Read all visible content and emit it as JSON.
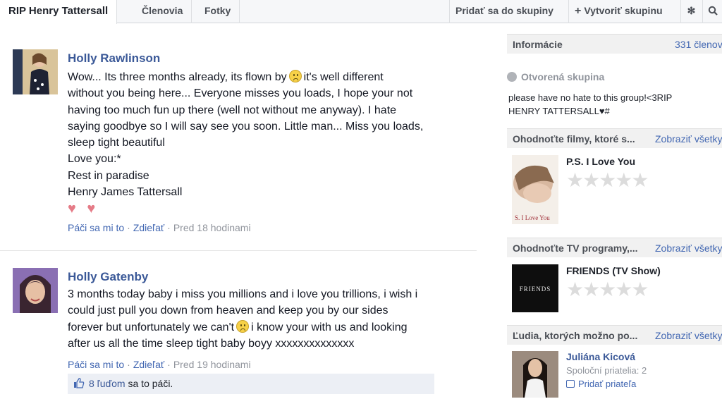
{
  "tabs": [
    {
      "label": "RIP Henry Tattersall"
    },
    {
      "label": "Členovia"
    },
    {
      "label": "Fotky"
    }
  ],
  "actions": {
    "join_label": "Pridať sa do skupiny",
    "create_label": "Vytvoriť skupinu"
  },
  "posts": [
    {
      "author": "Holly Rawlinson",
      "lines": [
        "Wow... Its three months already, its flown by",
        "it's well different",
        "without you being here... Everyone misses you loads, I hope your not",
        "having too much fun up there (well not without me anyway). I hate",
        "saying goodbye so I will say see you soon. Little man... Miss you loads,",
        "sleep tight beautiful",
        "Love you:*",
        "Rest in paradise",
        "Henry James Tattersall"
      ],
      "hearts": "♥ ♥",
      "like": "Páči sa mi to",
      "share": "Zdieľať",
      "time": "Pred 18 hodinami"
    },
    {
      "author": "Holly Gatenby",
      "lines": [
        "3 months today baby i miss you millions and i love you trillions, i wish i",
        "could just pull you down from heaven and keep you by our sides",
        "forever but unfortunately we can't",
        "i know your with us and looking",
        "after us all the time sleep tight baby boyy xxxxxxxxxxxxxx"
      ],
      "like": "Páči sa mi to",
      "share": "Zdieľať",
      "time": "Pred 19 hodinami",
      "likes_count": "8 ľuďom",
      "likes_suffix": "sa to páči."
    }
  ],
  "sidebar": {
    "info_label": "Informácie",
    "members": "331 členov",
    "group_type": "Otvorená skupina",
    "description_line1": "please have no hate to this group!<3RIP",
    "description_line2": "HENRY TATTERSALL♥#",
    "movies_head": "Ohodnoťte filmy, ktoré s...",
    "tv_head": "Ohodnoťte TV programy,...",
    "people_head": "Ľudia, ktorých možno po...",
    "see_all": "Zobraziť všetky",
    "movie_title": "P.S. I Love You",
    "poster_text": "S. I Love You",
    "tv_title": "FRIENDS (TV Show)",
    "tv_logo": "FRIENDS",
    "stars": "★★★★★",
    "person_name": "Juliána Kicová",
    "mutual": "Spoloční priatelia: 2",
    "add_friend": "Pridať priateľa"
  },
  "colors": {
    "link": "#3b5998",
    "meta": "#90949c",
    "heart": "#e57b87"
  }
}
